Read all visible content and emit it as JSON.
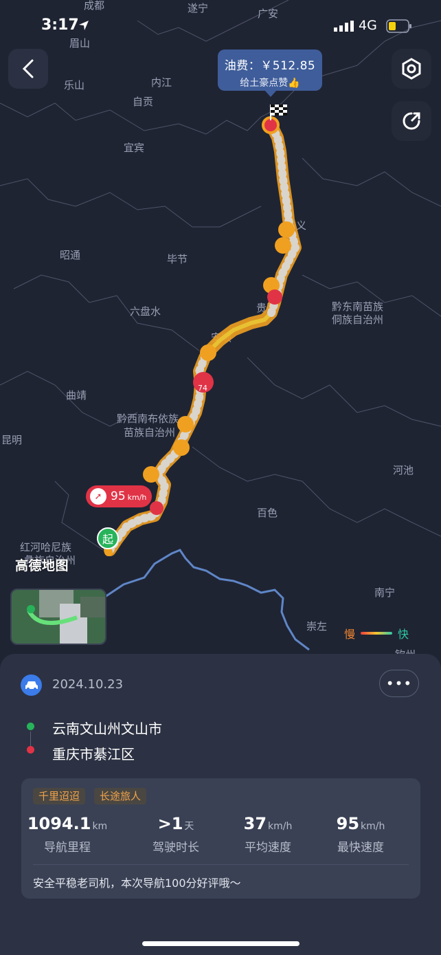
{
  "status_bar": {
    "time": "3:17",
    "network": "4G"
  },
  "map": {
    "cities": [
      {
        "name": "成都",
        "cls": "label"
      },
      {
        "name": "遂宁",
        "cls": "label"
      },
      {
        "name": "广安",
        "cls": "label"
      },
      {
        "name": "眉山",
        "cls": "label"
      },
      {
        "name": "乐山",
        "cls": "label"
      },
      {
        "name": "内江",
        "cls": "label"
      },
      {
        "name": "自贡",
        "cls": "label"
      },
      {
        "name": "宜宾",
        "cls": "label"
      },
      {
        "name": "昭通",
        "cls": "label"
      },
      {
        "name": "毕节",
        "cls": "label"
      },
      {
        "name": "六盘水",
        "cls": "label"
      },
      {
        "name": "贵阳",
        "cls": "label"
      },
      {
        "name": "安顺",
        "cls": "label"
      },
      {
        "name": "黔东南苗族",
        "cls": "label"
      },
      {
        "name": "侗族自治州",
        "cls": "label"
      },
      {
        "name": "曲靖",
        "cls": "label"
      },
      {
        "name": "黔西南布依族",
        "cls": "label"
      },
      {
        "name": "苗族自治州",
        "cls": "label"
      },
      {
        "name": "昆明",
        "cls": "label"
      },
      {
        "name": "河池",
        "cls": "label"
      },
      {
        "name": "百色",
        "cls": "label"
      },
      {
        "name": "红河哈尼族",
        "cls": "label"
      },
      {
        "name": "彝族自治州",
        "cls": "label"
      },
      {
        "name": "南宁",
        "cls": "label"
      },
      {
        "name": "崇左",
        "cls": "label"
      },
      {
        "name": "钦州",
        "cls": "label"
      },
      {
        "name": "义",
        "cls": "label"
      }
    ],
    "fuel_cost": "油费：￥512.85",
    "fuel_praise": "给土豪点赞👍",
    "max_speed_value": "95",
    "max_speed_unit": "km/h",
    "start_label": "起",
    "start_marker_value": "74",
    "watermark": "高德地图",
    "legend_slow": "慢",
    "legend_fast": "快"
  },
  "trip": {
    "date": "2024.10.23",
    "origin": "云南文山州文山市",
    "destination": "重庆市綦江区",
    "tags": [
      "千里迢迢",
      "长途旅人"
    ],
    "stats": [
      {
        "value": "1094.1",
        "unit": "km",
        "label": "导航里程"
      },
      {
        "value": ">1",
        "unit": "天",
        "label": "驾驶时长"
      },
      {
        "value": "37",
        "unit": "km/h",
        "label": "平均速度"
      },
      {
        "value": "95",
        "unit": "km/h",
        "label": "最快速度"
      }
    ],
    "note": "安全平稳老司机，本次导航100分好评哦～"
  },
  "colors": {
    "accent": "#3b7bea",
    "start_green": "#27b35a",
    "end_red": "#e13346",
    "route_orange": "#f0a020"
  }
}
